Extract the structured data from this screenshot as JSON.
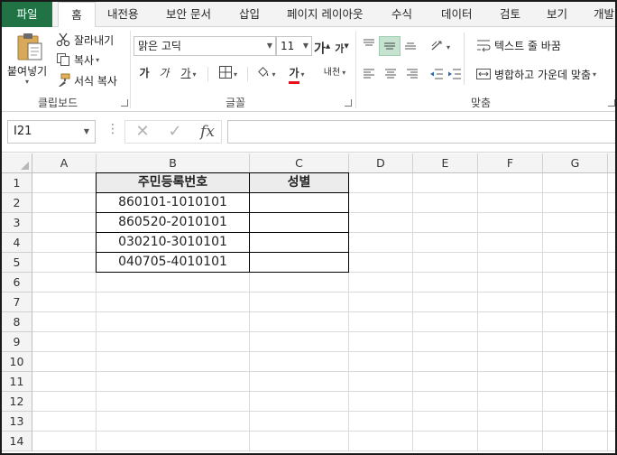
{
  "ribbon_tabs": [
    "파일",
    "홈",
    "내전용",
    "보안 문서",
    "삽입",
    "페이지 레이아웃",
    "수식",
    "데이터",
    "검토",
    "보기",
    "개발"
  ],
  "clipboard": {
    "paste": "붙여넣기",
    "cut": "잘라내기",
    "copy": "복사",
    "format_painter": "서식 복사",
    "group_label": "클립보드"
  },
  "font": {
    "name": "맑은 고딕",
    "size": "11",
    "grow": "가",
    "shrink": "가",
    "bold": "가",
    "italic": "가",
    "underline": "가",
    "color_glyph": "가",
    "phonetic": "내천",
    "group_label": "글꼴",
    "font_color": "#e8101c"
  },
  "alignment": {
    "wrap_text": "텍스트 줄 바꿈",
    "merge_center": "병합하고 가운데 맞춤",
    "group_label": "맞춤"
  },
  "formula_bar": {
    "name_box": "I21",
    "cancel": "✕",
    "enter": "✓",
    "fx": "fx",
    "value": ""
  },
  "columns": [
    "A",
    "B",
    "C",
    "D",
    "E",
    "F",
    "G"
  ],
  "rows": [
    "1",
    "2",
    "3",
    "4",
    "5",
    "6",
    "7",
    "8",
    "9",
    "10",
    "11",
    "12",
    "13",
    "14"
  ],
  "table": {
    "header_b": "주민등록번호",
    "header_c": "성별",
    "ids": [
      "860101-1010101",
      "860520-2010101",
      "030210-3010101",
      "040705-4010101"
    ],
    "gender": [
      "",
      "",
      "",
      ""
    ]
  },
  "colors": {
    "file_tab": "#217346",
    "selected_button": "#c5e3d0",
    "header_fill": "#ececec"
  }
}
